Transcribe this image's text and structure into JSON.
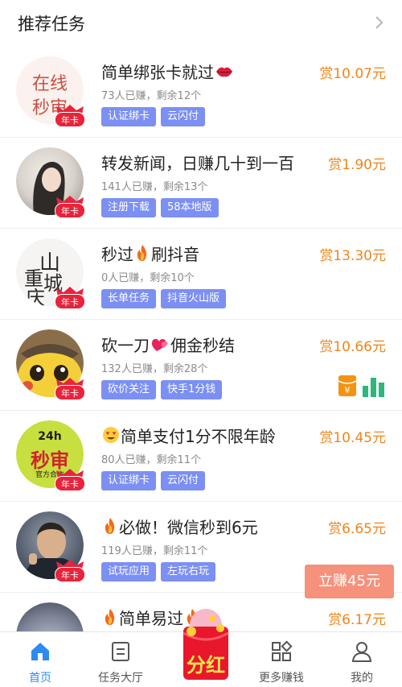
{
  "header": {
    "title": "推荐任务"
  },
  "tasks": [
    {
      "title": "简单绑张卡就过",
      "title_prefix": "",
      "emoji": "lips",
      "meta": "73人已赚，剩余12个",
      "tags": [
        "认证绑卡",
        "云闪付"
      ],
      "reward": "赏10.07元",
      "badge": "年卡",
      "avatar_text": "在线 秒审"
    },
    {
      "title": "转发新闻，日赚几十到一百",
      "title_prefix": "",
      "emoji": "",
      "meta": "141人已赚，剩余13个",
      "tags": [
        "注册下载",
        "58本地版"
      ],
      "reward": "赏1.90元",
      "badge": "年卡",
      "avatar_text": ""
    },
    {
      "title_prefix": "秒过",
      "emoji": "fire",
      "title": "刷抖音",
      "meta": "0人已赚，剩余10个",
      "tags": [
        "长单任务",
        "抖音火山版"
      ],
      "reward": "赏13.30元",
      "badge": "年卡",
      "avatar_text": "重庆 山城"
    },
    {
      "title_prefix": "砍一刀",
      "emoji": "heart",
      "title": "佣金秒结",
      "meta": "132人已赚，剩余28个",
      "tags": [
        "砍价关注",
        "快手1分钱"
      ],
      "reward": "赏10.66元",
      "badge": "年卡",
      "avatar_text": ""
    },
    {
      "title_prefix": "",
      "emoji": "hearteyes",
      "title": "简单支付1分不限年龄",
      "meta": "80人已赚，剩余11个",
      "tags": [
        "认证绑卡",
        "云闪付"
      ],
      "reward": "赏10.45元",
      "badge": "年卡",
      "avatar_text": "24h 秒审 官方合作"
    },
    {
      "title_prefix": "",
      "emoji": "fire",
      "title": "必做！微信秒到6元",
      "meta": "119人已赚，剩余11个",
      "tags": [
        "试玩应用",
        "左玩右玩"
      ],
      "reward": "赏6.65元",
      "badge": "年卡",
      "avatar_text": ""
    },
    {
      "title_prefix": "",
      "emoji": "fire",
      "title": "简单易过",
      "meta": "",
      "tags": [],
      "reward": "赏6.17元",
      "badge": "",
      "avatar_text": ""
    }
  ],
  "float_button": {
    "label": "立赚45元"
  },
  "center_badge": {
    "label": "分红"
  },
  "tabbar": [
    {
      "label": "首页",
      "icon": "home-icon",
      "active": true
    },
    {
      "label": "任务大厅",
      "icon": "document-icon",
      "active": false
    },
    {
      "label": "",
      "icon": "",
      "active": false
    },
    {
      "label": "更多赚钱",
      "icon": "grid-icon",
      "active": false
    },
    {
      "label": "我的",
      "icon": "user-icon",
      "active": false
    }
  ],
  "colors": {
    "reward": "#f08419",
    "tag": "#7c8ff2",
    "accent": "#2d8bef",
    "badge": "#e8233c",
    "float_button": "#f6917b"
  }
}
